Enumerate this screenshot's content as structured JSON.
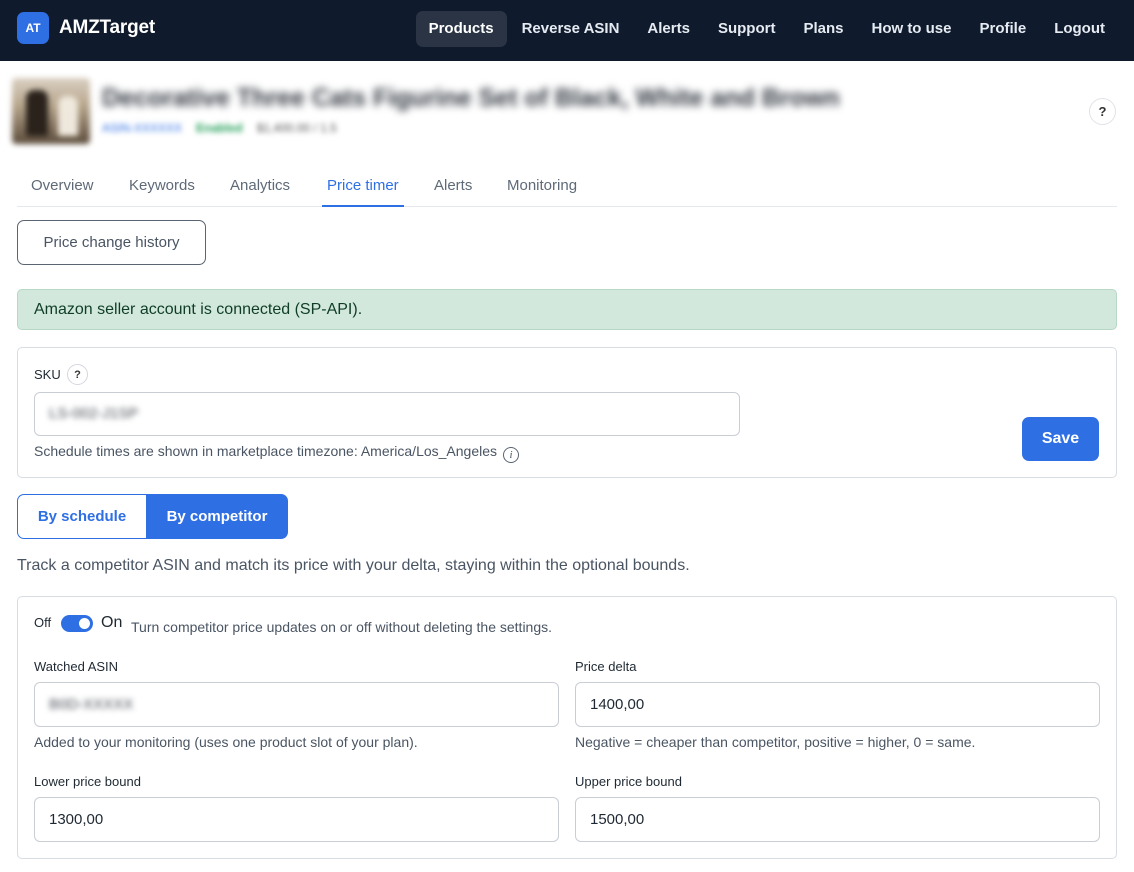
{
  "nav": {
    "logo_badge": "AT",
    "brand": "AMZTarget",
    "links": [
      "Products",
      "Reverse ASIN",
      "Alerts",
      "Support",
      "Plans",
      "How to use",
      "Profile",
      "Logout"
    ],
    "active_index": 0
  },
  "product": {
    "title": "Decorative Three Cats Figurine Set of Black, White and Brown",
    "link_text": "ASIN-XXXXXX",
    "status": "Enabled",
    "price": "$1,400.00 / 1.5"
  },
  "help_label": "?",
  "tabs": [
    "Overview",
    "Keywords",
    "Analytics",
    "Price timer",
    "Alerts",
    "Monitoring"
  ],
  "active_tab": "Price timer",
  "history_button": "Price change history",
  "alert_text": "Amazon seller account is connected (SP-API).",
  "sku_section": {
    "label": "SKU",
    "help": "?",
    "value": "LS-002-J1SP",
    "hint": "Schedule times are shown in marketplace timezone: America/Los_Angeles",
    "info_icon": "i",
    "save_label": "Save"
  },
  "mode": {
    "schedule_label": "By schedule",
    "competitor_label": "By competitor",
    "selected": "By competitor"
  },
  "description": "Track a competitor ASIN and match its price with your delta, staying within the optional bounds.",
  "competitor": {
    "toggle_off": "Off",
    "toggle_on": "On",
    "toggle_state": true,
    "toggle_desc": "Turn competitor price updates on or off without deleting the settings.",
    "watched_asin_label": "Watched ASIN",
    "watched_asin_value": "B0D-XXXXX",
    "watched_asin_hint": "Added to your monitoring (uses one product slot of your plan).",
    "price_delta_label": "Price delta",
    "price_delta_value": "1400,00",
    "price_delta_hint": "Negative = cheaper than competitor, positive = higher, 0 = same.",
    "lower_label": "Lower price bound",
    "lower_value": "1300,00",
    "upper_label": "Upper price bound",
    "upper_value": "1500,00"
  },
  "colors": {
    "nav_bg": "#0f1b2d",
    "accent": "#2f6fe4",
    "success_bg": "#d2e8dc"
  }
}
